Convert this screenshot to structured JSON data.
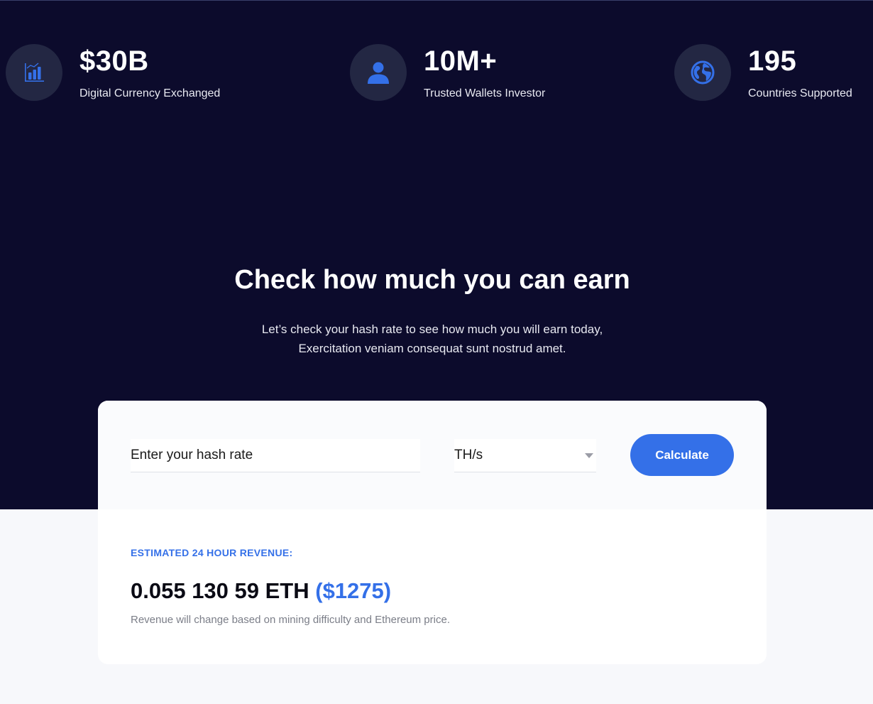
{
  "stats": [
    {
      "icon": "bar-chart-icon",
      "value": "$30B",
      "label": "Digital Currency Exchanged"
    },
    {
      "icon": "user-icon",
      "value": "10M+",
      "label": "Trusted Wallets Investor"
    },
    {
      "icon": "globe-icon",
      "value": "195",
      "label": "Countries Supported"
    }
  ],
  "calculator": {
    "title": "Check how much you can earn",
    "subtitle_line1": "Let’s check your hash rate to see how much you will earn today,",
    "subtitle_line2": "Exercitation veniam consequat sunt nostrud amet.",
    "hash_input_placeholder": "Enter your hash rate",
    "unit_selected": "TH/s",
    "button_label": "Calculate"
  },
  "revenue": {
    "label": "ESTIMATED 24 HOUR REVENUE:",
    "eth_amount": "0.055 130 59 ETH",
    "usd_amount": "($1275)",
    "note": "Revenue will change based on mining difficulty and Ethereum price."
  },
  "colors": {
    "dark_background": "#0c0b2c",
    "accent": "#3470e8",
    "icon_circle": "#232743",
    "light_background": "#f7f8fb"
  }
}
